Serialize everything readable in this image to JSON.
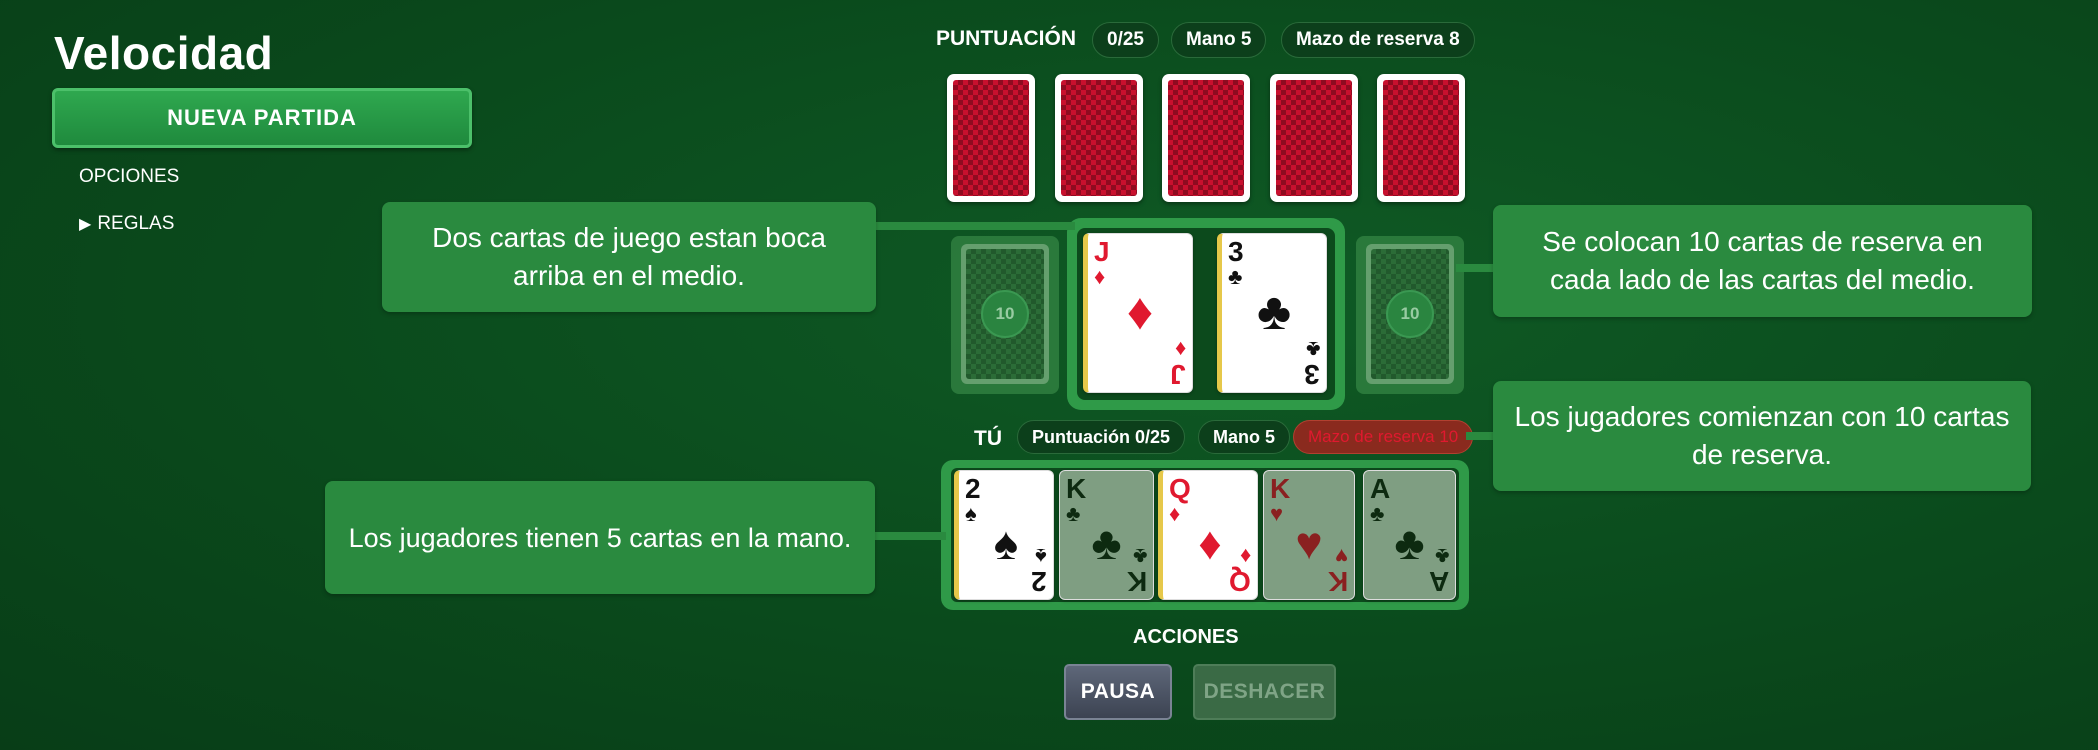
{
  "app": {
    "title": "Velocidad",
    "new_game_label": "NUEVA PARTIDA"
  },
  "menu": {
    "options_label": "OPCIONES",
    "rules_icon": "triangle-right-icon",
    "rules_label": "REGLAS"
  },
  "opponent": {
    "label": "PUNTUACIÓN",
    "score": "0/25",
    "hand": "Mano 5",
    "reserve": "Mazo de reserva 8"
  },
  "center": {
    "left_reserve_count": "10",
    "right_reserve_count": "10",
    "cards": [
      {
        "rank": "J",
        "suit": "♦",
        "color": "red"
      },
      {
        "rank": "3",
        "suit": "♣",
        "color": "black"
      }
    ]
  },
  "player": {
    "label": "TÚ",
    "score": "Puntuación 0/25",
    "hand": "Mano 5",
    "reserve": "Mazo de reserva 10",
    "cards": [
      {
        "rank": "2",
        "suit": "♠",
        "color": "black",
        "state": "active"
      },
      {
        "rank": "K",
        "suit": "♣",
        "color": "black",
        "state": "dim"
      },
      {
        "rank": "Q",
        "suit": "♦",
        "color": "red",
        "state": "active"
      },
      {
        "rank": "K",
        "suit": "♥",
        "color": "red",
        "state": "dim"
      },
      {
        "rank": "A",
        "suit": "♣",
        "color": "black",
        "state": "dim"
      }
    ]
  },
  "callouts": {
    "middle_cards": "Dos cartas de juego estan boca arriba en el medio.",
    "reserve_sides": "Se colocan 10 cartas de reserva en cada lado de las cartas del medio.",
    "players_reserve": "Los jugadores comienzan con 10 cartas de reserva.",
    "hand": "Los jugadores tienen 5 cartas en la mano."
  },
  "actions": {
    "label": "ACCIONES",
    "pause": "PAUSA",
    "undo": "DESHACER"
  },
  "colors": {
    "felt": "#0a4a1c",
    "accent": "#2a8a3f",
    "reserve_badge": "#8a2a1e"
  }
}
